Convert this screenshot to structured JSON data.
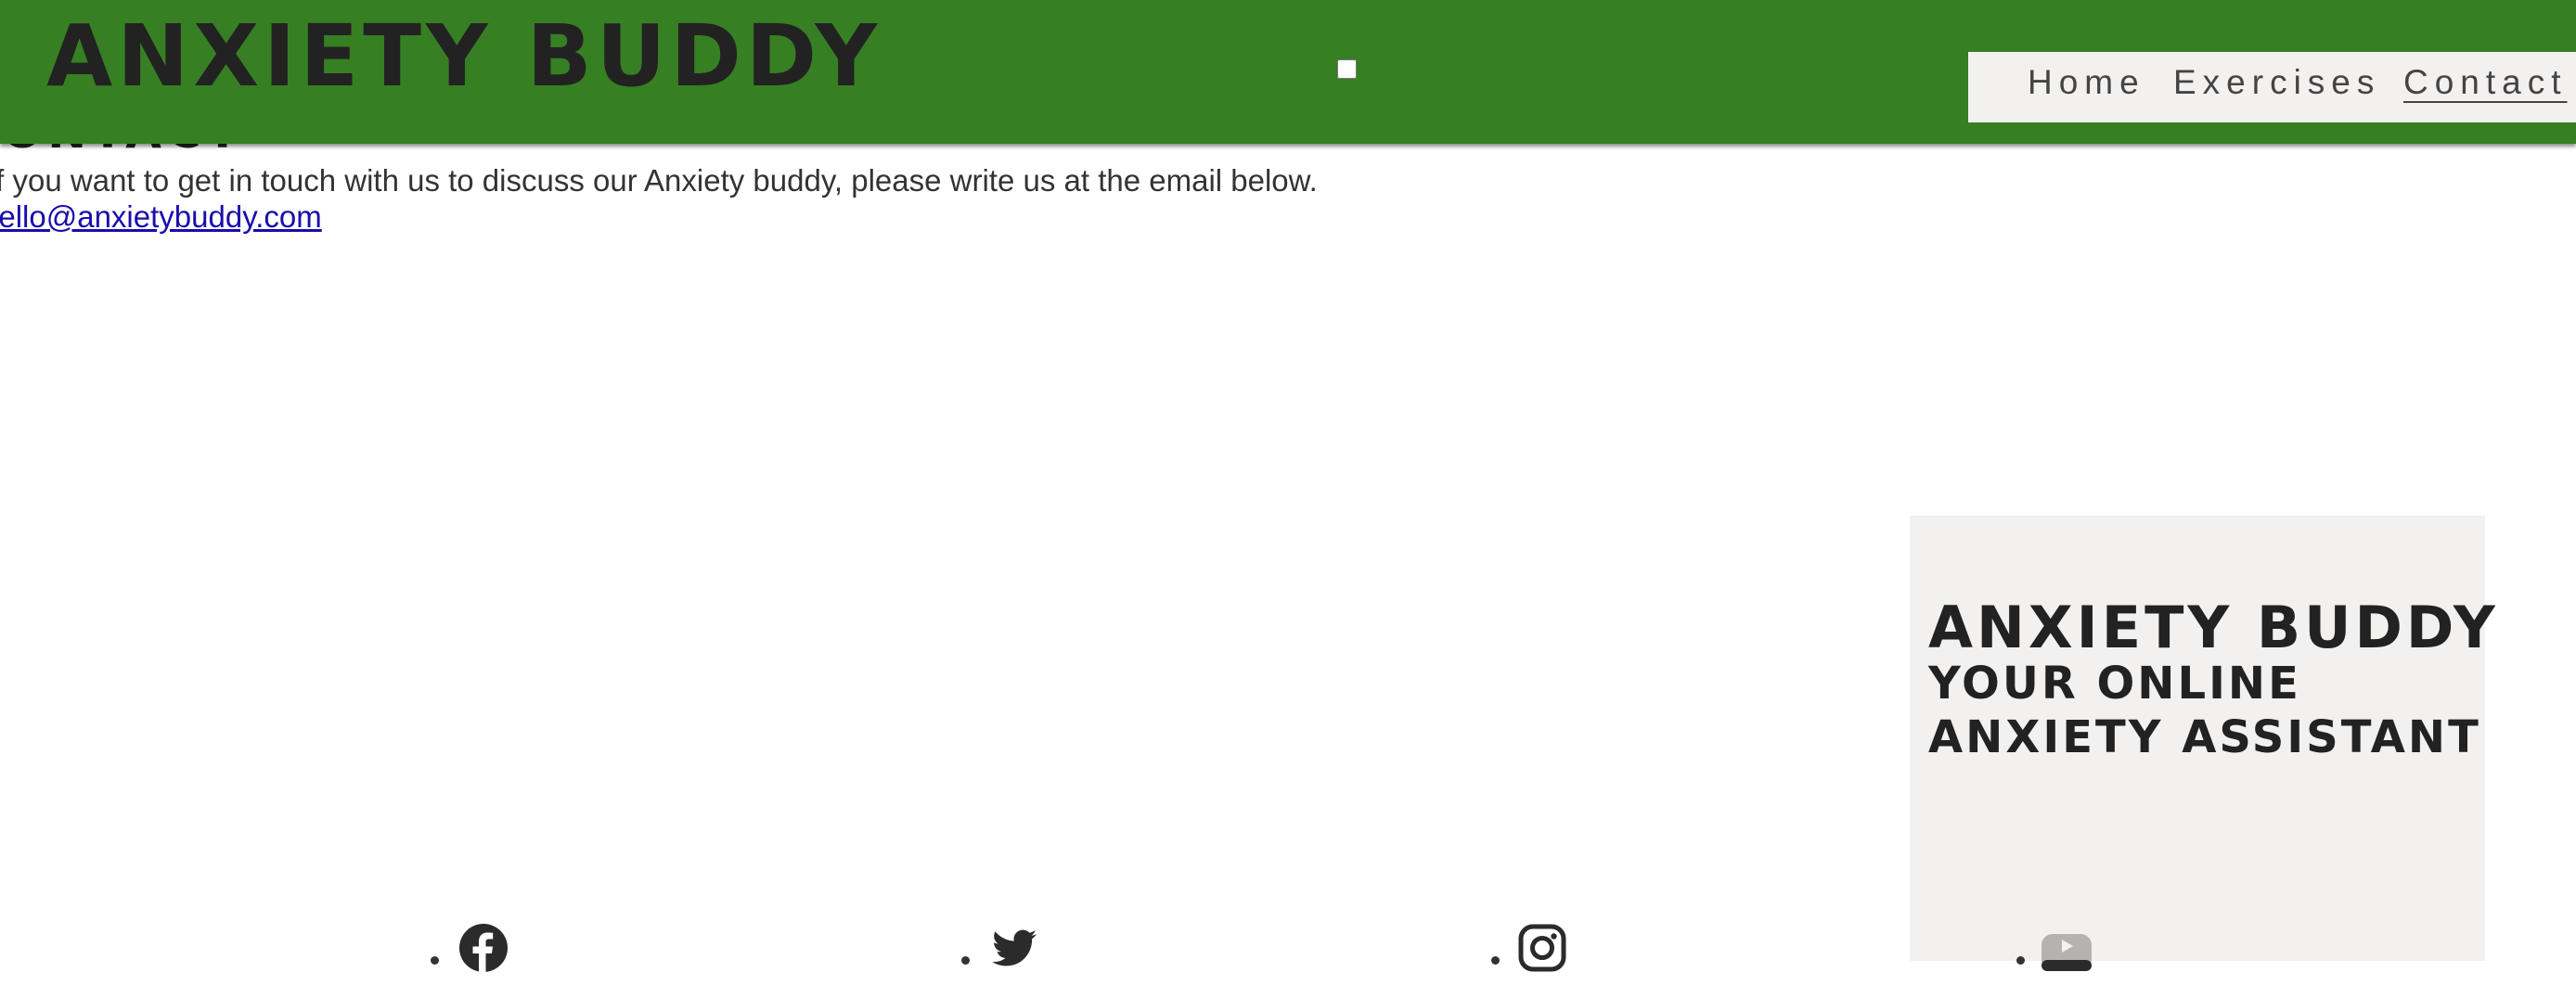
{
  "header": {
    "brand": "ANXIETY BUDDY",
    "nav": [
      {
        "label": "Home"
      },
      {
        "label": "Exercises"
      },
      {
        "label": "Contact",
        "current": true
      }
    ]
  },
  "main": {
    "heading": "CONTACT",
    "text": "If you want to get in touch with us to discuss our Anxiety buddy, please write us at the email below.",
    "email": "hello@anxietybuddy.com"
  },
  "aside": {
    "title": "ANXIETY BUDDY",
    "subtitle": "YOUR ONLINE ANXIETY ASSISTANT"
  },
  "social": [
    {
      "icon": "facebook-icon"
    },
    {
      "icon": "twitter-icon"
    },
    {
      "icon": "instagram-icon"
    },
    {
      "icon": "youtube-icon"
    }
  ],
  "colors": {
    "header_bg": "#377f23",
    "nav_bg": "#f3f1f0",
    "card_bg": "#f3f1f0",
    "link": "#1a0dab",
    "text": "#222222"
  }
}
